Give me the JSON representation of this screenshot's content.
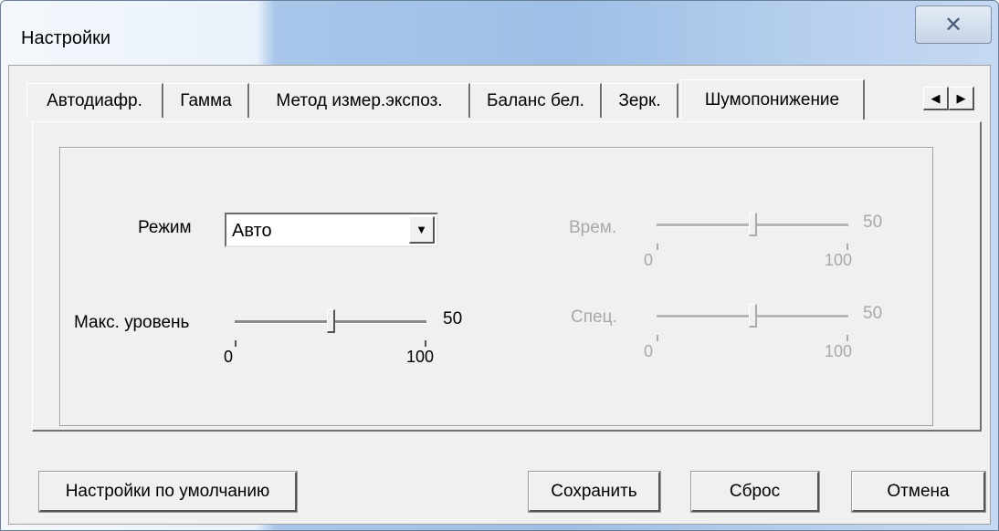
{
  "window": {
    "title": "Настройки",
    "close_glyph": "✕"
  },
  "tabs": [
    {
      "label": "Автодиафр."
    },
    {
      "label": "Гамма"
    },
    {
      "label": "Метод измер.экспоз."
    },
    {
      "label": "Баланс бел."
    },
    {
      "label": "Зерк."
    },
    {
      "label": "Шумопонижение",
      "active": true
    }
  ],
  "tab_scroll": {
    "left_icon": "◀",
    "right_icon": "▶"
  },
  "mode": {
    "label": "Режим",
    "value": "Авто",
    "dropdown_icon": "▼"
  },
  "sliders": {
    "max_level": {
      "label": "Макс. уровень",
      "value": "50",
      "level": 50,
      "min": "0",
      "max": "100",
      "enabled": true
    },
    "time": {
      "label": "Врем.",
      "value": "50",
      "level": 50,
      "min": "0",
      "max": "100",
      "enabled": false
    },
    "spec": {
      "label": "Спец.",
      "value": "50",
      "level": 50,
      "min": "0",
      "max": "100",
      "enabled": false
    }
  },
  "buttons": {
    "defaults": "Настройки по умолчанию",
    "save": "Сохранить",
    "reset": "Сброс",
    "cancel": "Отмена"
  }
}
